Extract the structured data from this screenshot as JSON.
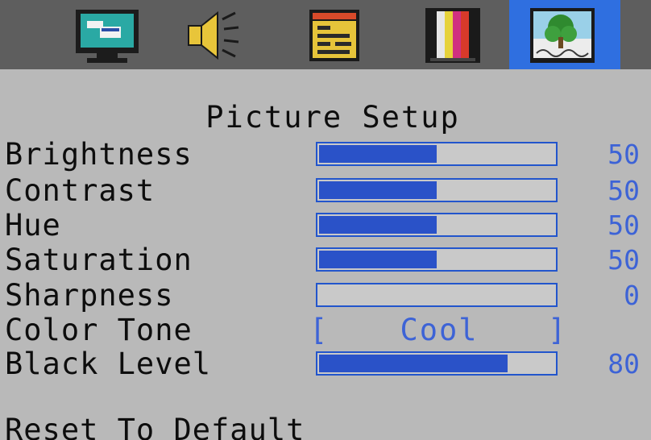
{
  "tabs": [
    {
      "icon": "monitor-setup-icon",
      "active": false
    },
    {
      "icon": "speaker-icon",
      "active": false
    },
    {
      "icon": "menu-panel-icon",
      "active": false
    },
    {
      "icon": "color-bars-icon",
      "active": false
    },
    {
      "icon": "tree-picture-icon",
      "active": true
    }
  ],
  "menu": {
    "title": "Picture Setup",
    "items": {
      "brightness": {
        "label": "Brightness",
        "value": "50",
        "level": 0.5
      },
      "contrast": {
        "label": "Contrast",
        "value": "50",
        "level": 0.5
      },
      "hue": {
        "label": "Hue",
        "value": "50",
        "level": 0.5
      },
      "saturation": {
        "label": "Saturation",
        "value": "50",
        "level": 0.5
      },
      "sharpness": {
        "label": "Sharpness",
        "value": "0",
        "level": 0.0
      },
      "color_tone": {
        "label": "Color Tone",
        "value": "Cool",
        "bracket_left": "[",
        "bracket_right": "]"
      },
      "black_level": {
        "label": "Black Level",
        "value": "80",
        "level": 0.8
      }
    },
    "reset_label": "Reset To Default"
  },
  "colors": {
    "background": "#b9b9b9",
    "tabbar": "#5e5e5e",
    "active_tab": "#2f6fe0",
    "accent": "#3d63d6",
    "bar_fill": "#2a52c8",
    "text": "#0d0d0d"
  }
}
